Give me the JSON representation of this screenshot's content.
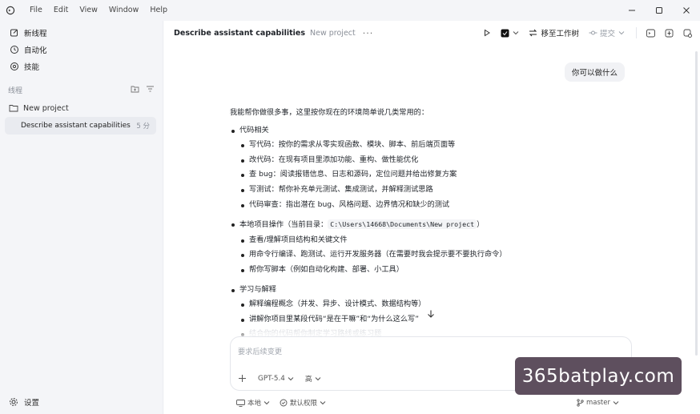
{
  "menu": [
    "File",
    "Edit",
    "View",
    "Window",
    "Help"
  ],
  "sidebar": {
    "nav": [
      {
        "label": "新线程",
        "icon": "new-thread-icon"
      },
      {
        "label": "自动化",
        "icon": "clock-icon"
      },
      {
        "label": "技能",
        "icon": "skills-icon"
      }
    ],
    "section_title": "线程",
    "project": "New project",
    "thread": {
      "title": "Describe assistant capabilities",
      "age": "5 分"
    },
    "settings": "设置"
  },
  "header": {
    "title": "Describe assistant capabilities",
    "project": "New project",
    "more": "···",
    "move_label": "移至工作树",
    "commit_label": "提交"
  },
  "conversation": {
    "user_message": "你可以做什么",
    "intro": "我能帮你做很多事，这里按你现在的环境简单说几类常用的：",
    "sections": [
      {
        "title": "代码相关",
        "items": [
          "写代码：按你的需求从零实现函数、模块、脚本、前后端页面等",
          "改代码：在现有项目里添加功能、重构、做性能优化",
          "查 bug：阅读报错信息、日志和源码，定位问题并给出修复方案",
          "写测试：帮你补充单元测试、集成测试，并解释测试思路",
          "代码审查：指出潜在 bug、风格问题、边界情况和缺少的测试"
        ]
      },
      {
        "title_prefix": "本地项目操作（当前目录：",
        "title_code": "C:\\Users\\14668\\Documents\\New project",
        "title_suffix": "）",
        "items": [
          "查看/理解项目结构和关键文件",
          "用命令行编译、跑测试、运行开发服务器（在需要时我会提示要不要执行命令）",
          "帮你写脚本（例如自动化构建、部署、小工具）"
        ]
      },
      {
        "title": "学习与解释",
        "items": [
          "解释编程概念（并发、异步、设计模式、数据结构等）",
          "讲解你项目里某段代码“是在干嘛”和“为什么这么写”",
          "结合你的代码帮你制定学习路线或练习题"
        ]
      }
    ]
  },
  "composer": {
    "placeholder": "要求后续变更",
    "model": "GPT-5.4",
    "effort": "高"
  },
  "statusbar": {
    "env": "本地",
    "permission": "默认权限",
    "branch": "master"
  },
  "watermark": "365batplay.com",
  "colors": {
    "sidebar_bg": "#f4f5f8",
    "accent_dark": "#1f2329",
    "watermark_bg": "#5e4f5e"
  }
}
